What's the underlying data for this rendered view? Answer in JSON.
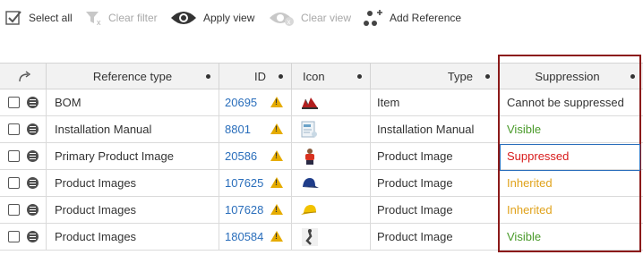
{
  "toolbar": {
    "select_all": "Select all",
    "clear_filter": "Clear filter",
    "apply_view": "Apply view",
    "clear_view": "Clear view",
    "add_reference": "Add Reference"
  },
  "columns": {
    "reference_type": "Reference type",
    "id": "ID",
    "icon": "Icon",
    "type": "Type",
    "suppression": "Suppression"
  },
  "colors": {
    "suppression": {
      "Cannot be suppressed": "#333333",
      "Visible": "#4a9a2a",
      "Suppressed": "#d81b1b",
      "Inherited": "#e0a21b"
    },
    "link": "#2a6ebb",
    "highlight_border": "#8b1a1a"
  },
  "rows": [
    {
      "reference_type": "BOM",
      "id": "20695",
      "icon": "shoes-icon",
      "type": "Item",
      "suppression": "Cannot be suppressed"
    },
    {
      "reference_type": "Installation Manual",
      "id": "8801",
      "icon": "manual-icon",
      "type": "Installation Manual",
      "suppression": "Visible"
    },
    {
      "reference_type": "Primary Product Image",
      "id": "20586",
      "icon": "person-icon",
      "type": "Product Image",
      "suppression": "Suppressed"
    },
    {
      "reference_type": "Product Images",
      "id": "107625",
      "icon": "blue-cap-icon",
      "type": "Product Image",
      "suppression": "Inherited"
    },
    {
      "reference_type": "Product Images",
      "id": "107628",
      "icon": "yellow-cap-icon",
      "type": "Product Image",
      "suppression": "Inherited"
    },
    {
      "reference_type": "Product Images",
      "id": "180584",
      "icon": "figure-icon",
      "type": "Product Image",
      "suppression": "Visible"
    }
  ]
}
